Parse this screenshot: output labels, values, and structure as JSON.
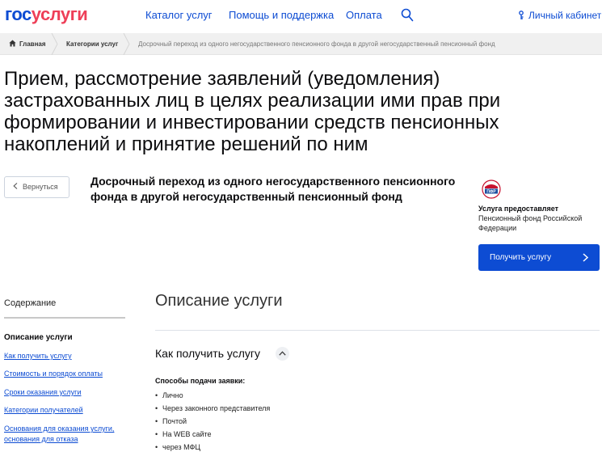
{
  "header": {
    "logo_part1": "гос",
    "logo_part2": "услуги",
    "nav": [
      "Каталог услуг",
      "Помощь и поддержка",
      "Оплата"
    ],
    "cabinet": "Личный кабинет"
  },
  "breadcrumbs": [
    "Главная",
    "Категории услуг",
    "Досрочный переход из одного негосударственного пенсионного фонда в другой негосударственный пенсионный фонд"
  ],
  "page": {
    "title": "Прием, рассмотрение заявлений (уведомления) застрахованных лиц в целях реализации ими прав при формировании и инвестировании средств пенсионных накоплений и принятие решений по ним",
    "back_label": "Вернуться",
    "subtitle": "Досрочный переход из одного негосударственного пенсионного фонда в другой негосударственный пенсионный фонд"
  },
  "provider": {
    "logo_text": "ПФР",
    "label": "Услуга предоставляет",
    "name": "Пенсионный фонд Российской Федерации",
    "button_label": "Получить услугу"
  },
  "sidebar": {
    "title": "Содержание",
    "active": "Описание услуги",
    "links": [
      "Как получить услугу",
      "Стоимость и порядок оплаты",
      "Сроки оказания услуги",
      "Категории получателей",
      "Основания для оказания услуги,",
      "основания для отказа"
    ]
  },
  "main": {
    "section_title": "Описание услуги",
    "how_title": "Как получить услугу",
    "methods_title": "Способы подачи заявки:",
    "methods": [
      "Лично",
      "Через законного представителя",
      "Почтой",
      "На WEB сайте",
      "через МФЦ"
    ]
  },
  "colors": {
    "accent": "#0d4cd3",
    "logo_red": "#ee3f58",
    "breadcrumb_bg": "#f0f0f0"
  }
}
